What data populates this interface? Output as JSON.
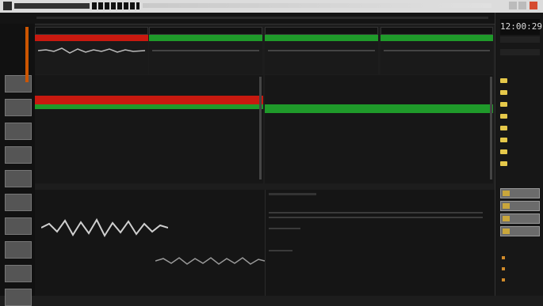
{
  "clock": "12:00:29",
  "decks": [
    {
      "color": "#c8190f"
    },
    {
      "color": "#1f9a2a"
    },
    {
      "color": "#1f9a2a"
    },
    {
      "color": "#1f9a2a"
    }
  ]
}
